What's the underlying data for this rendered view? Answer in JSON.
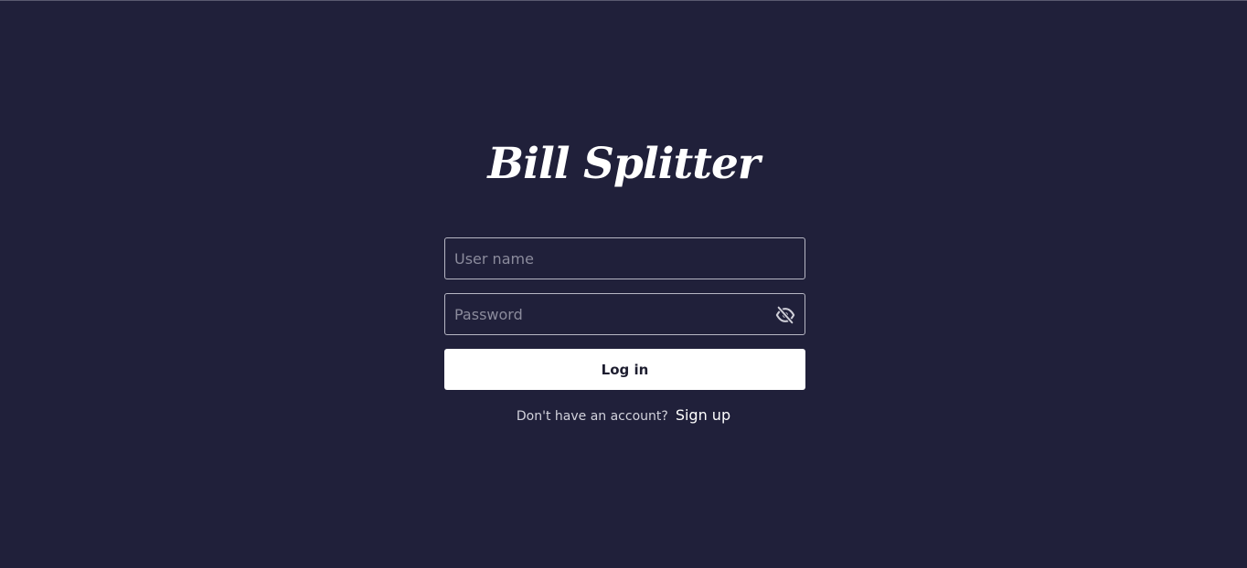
{
  "app": {
    "title": "Bill Splitter"
  },
  "form": {
    "username_placeholder": "User name",
    "username_value": "",
    "password_placeholder": "Password",
    "password_value": "",
    "toggle_icon": "eye-off-icon",
    "login_label": "Log in"
  },
  "footer": {
    "prompt": "Don't have an account?",
    "signup_label": "Sign up"
  },
  "colors": {
    "background": "#20203a",
    "button_bg": "#ffffff",
    "button_text": "#1e1e30",
    "border": "#b7b7c4"
  }
}
